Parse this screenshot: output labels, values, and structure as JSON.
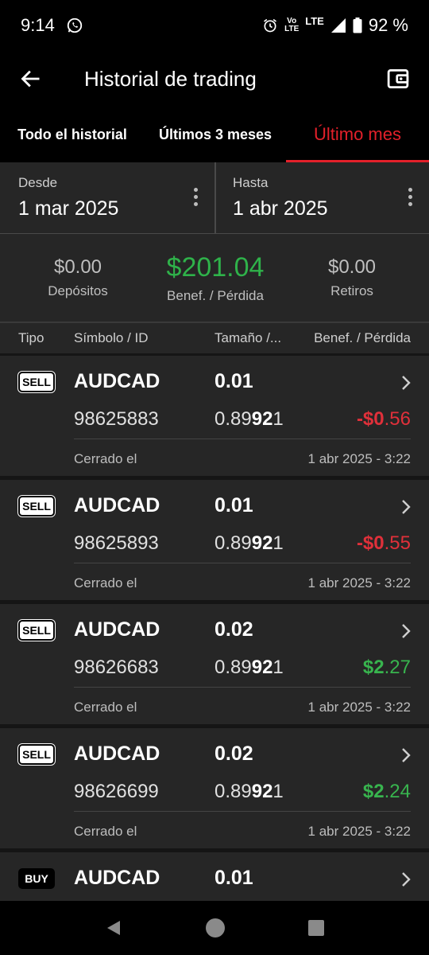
{
  "status": {
    "time": "9:14",
    "volte_top": "Vo",
    "volte_bottom": "LTE",
    "lte": "LTE",
    "battery": "92 %"
  },
  "header": {
    "title": "Historial de trading"
  },
  "tabs": [
    {
      "label": "Todo el historial",
      "active": false
    },
    {
      "label": "Últimos 3 meses",
      "active": false
    },
    {
      "label": "Último mes",
      "active": true
    }
  ],
  "dates": {
    "from_label": "Desde",
    "from_value": "1 mar 2025",
    "to_label": "Hasta",
    "to_value": "1 abr 2025"
  },
  "summary": {
    "deposits_value": "$0.00",
    "deposits_label": "Depósitos",
    "pl_value": "$201.04",
    "pl_label": "Benef. / Pérdida",
    "withdrawals_value": "$0.00",
    "withdrawals_label": "Retiros"
  },
  "columns": {
    "type": "Tipo",
    "symbol": "Símbolo / ID",
    "size": "Tamaño /...",
    "pl": "Benef. / Pérdida"
  },
  "trades": [
    {
      "type": "SELL",
      "symbol": "AUDCAD",
      "size": "0.01",
      "id": "98625883",
      "price_a": "0.89",
      "price_b": "92",
      "price_c": "1",
      "pl_a": "-$0",
      "pl_b": ".56",
      "closed_label": "Cerrado el",
      "closed_date": "1 abr 2025 - 3:22"
    },
    {
      "type": "SELL",
      "symbol": "AUDCAD",
      "size": "0.01",
      "id": "98625893",
      "price_a": "0.89",
      "price_b": "92",
      "price_c": "1",
      "pl_a": "-$0",
      "pl_b": ".55",
      "closed_label": "Cerrado el",
      "closed_date": "1 abr 2025 - 3:22"
    },
    {
      "type": "SELL",
      "symbol": "AUDCAD",
      "size": "0.02",
      "id": "98626683",
      "price_a": "0.89",
      "price_b": "92",
      "price_c": "1",
      "pl_a": "$2",
      "pl_b": ".27",
      "closed_label": "Cerrado el",
      "closed_date": "1 abr 2025 - 3:22"
    },
    {
      "type": "SELL",
      "symbol": "AUDCAD",
      "size": "0.02",
      "id": "98626699",
      "price_a": "0.89",
      "price_b": "92",
      "price_c": "1",
      "pl_a": "$2",
      "pl_b": ".24",
      "closed_label": "Cerrado el",
      "closed_date": "1 abr 2025 - 3:22"
    },
    {
      "type": "BUY",
      "symbol": "AUDCAD",
      "size": "0.01"
    }
  ],
  "colors": {
    "accent": "#e3202a",
    "profit": "#38b44e",
    "loss": "#e0303a",
    "panel": "#262626"
  },
  "icons": {
    "back": "arrow-left-icon",
    "wallet": "wallet-icon",
    "menu": "kebab-icon",
    "chevron": "chevron-right-icon"
  }
}
